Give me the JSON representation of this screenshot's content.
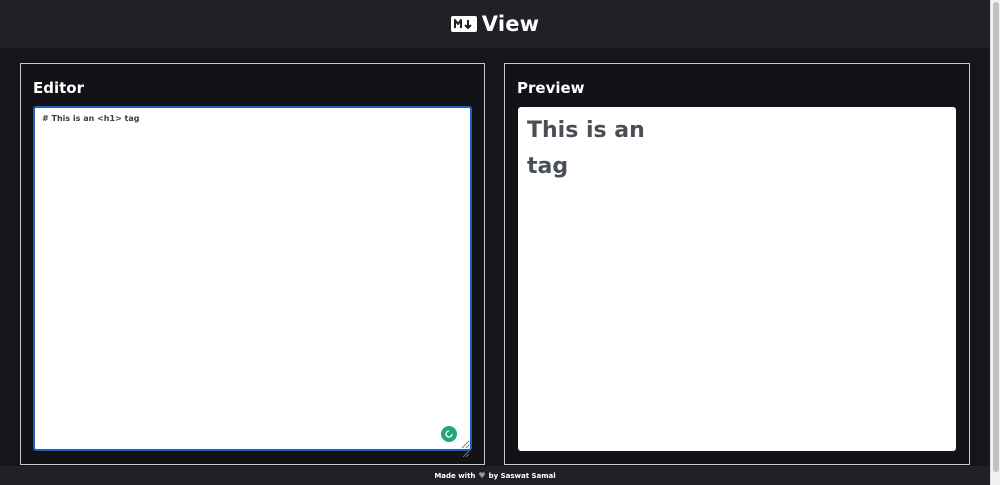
{
  "header": {
    "logo_icon": "markdown-icon",
    "title": "View"
  },
  "editor": {
    "title": "Editor",
    "content": "# This is an <h1> tag",
    "assist_icon": "grammar-assistant-icon"
  },
  "preview": {
    "title": "Preview",
    "heading": "This is an tag"
  },
  "footer": {
    "made_with": "Made with",
    "heart_icon": "heart-icon",
    "by": "by Saswat Samal"
  },
  "colors": {
    "background": "#15161a",
    "header": "#202126",
    "editor_focus_border": "#1f5fbf",
    "assist_badge": "#1fa67e",
    "preview_text": "#4a4e56"
  }
}
